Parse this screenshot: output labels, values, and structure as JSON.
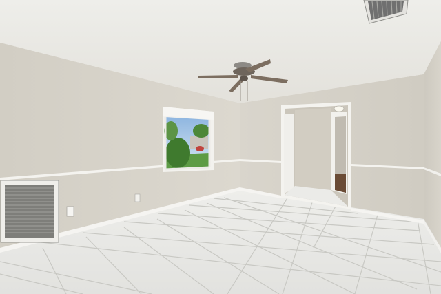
{
  "scene": {
    "description_free": true,
    "colors": {
      "ceiling": "#f1f0ec",
      "ceiling_shade": "#e6e4de",
      "wall_left": "#d8d4cb",
      "wall_back": "#d6d2c8",
      "wall_right": "#cfcbc1",
      "chair_rail": "#f4f2ee",
      "baseboard": "#f7f6f3",
      "floor_tile": "#e9e9e6",
      "grout": "#c9c9c4",
      "door_frame": "#f3f2ee",
      "hall_wall": "#cbc6bb",
      "vent": "#8f8f8b",
      "fan_blade": "#7a6a5a",
      "fan_body": "#6b625a",
      "window_sky": "#9fc2e6",
      "window_tree": "#4f8a3a"
    },
    "icons": {
      "ceiling_fan": "ceiling-fan-icon",
      "ceiling_vent": "vent-icon",
      "wall_vent": "vent-icon",
      "outlet": "outlet-icon",
      "light": "light-fixture-icon"
    }
  }
}
